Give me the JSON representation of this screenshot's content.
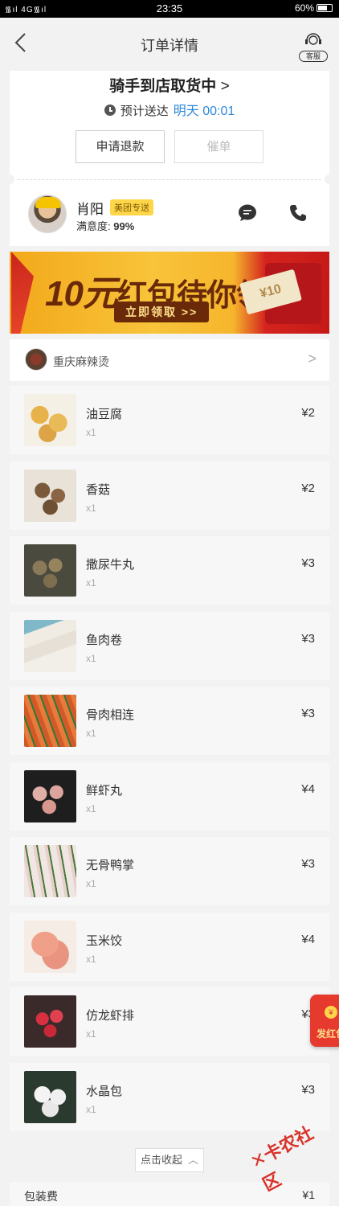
{
  "statusbar": {
    "signal": "᯾ıl 4G᯾ıl",
    "time": "23:35",
    "battery": "60%"
  },
  "header": {
    "title": "订单详情",
    "cs_label": "客服"
  },
  "order_status": {
    "title": "骑手到店取货中",
    "eta_label": "预计送达",
    "eta_time": "明天 00:01",
    "refund_button": "申请退款",
    "urge_button": "催单"
  },
  "rider": {
    "name": "肖阳",
    "badge": "美团专送",
    "satisfaction_label": "满意度:",
    "satisfaction_value": "99%"
  },
  "banner": {
    "amount": "10元",
    "text": "红包待你领取",
    "cta": "立即领取 >>",
    "coupon_value": "¥10"
  },
  "shop": {
    "name": "重庆麻辣烫"
  },
  "items": [
    {
      "name": "油豆腐",
      "qty": "x1",
      "price": "¥2"
    },
    {
      "name": "香菇",
      "qty": "x1",
      "price": "¥2"
    },
    {
      "name": "撒尿牛丸",
      "qty": "x1",
      "price": "¥3"
    },
    {
      "name": "鱼肉卷",
      "qty": "x1",
      "price": "¥3"
    },
    {
      "name": "骨肉相连",
      "qty": "x1",
      "price": "¥3"
    },
    {
      "name": "鲜虾丸",
      "qty": "x1",
      "price": "¥4"
    },
    {
      "name": "无骨鸭掌",
      "qty": "x1",
      "price": "¥3"
    },
    {
      "name": "玉米饺",
      "qty": "x1",
      "price": "¥4"
    },
    {
      "name": "仿龙虾排",
      "qty": "x1",
      "price": "¥3"
    },
    {
      "name": "水晶包",
      "qty": "x1",
      "price": "¥3"
    }
  ],
  "collapse_label": "点击收起",
  "packaging": {
    "label": "包装费",
    "value": "¥1"
  },
  "float_button": {
    "label": "发红包"
  },
  "watermark": {
    "text": "卡农社区"
  }
}
